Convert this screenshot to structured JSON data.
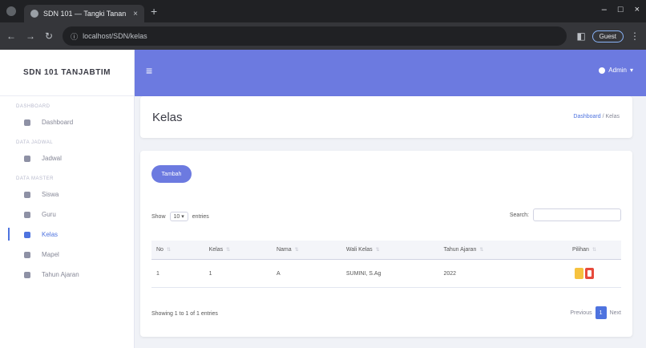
{
  "browser": {
    "tab_title": "SDN 101 — Tangki Tanan",
    "tab_close": "×",
    "new_tab": "+",
    "window_controls": [
      "–",
      "□",
      "×"
    ],
    "address": "localhost/SDN/kelas",
    "profile": "Guest"
  },
  "sidebar": {
    "brand": "SDN 101 TANJABTIM",
    "headings": [
      "DASHBOARD",
      "DATA JADWAL",
      "DATA MASTER"
    ],
    "items": [
      {
        "label": "Dashboard",
        "icon": "gauge-icon"
      },
      {
        "label": "Jadwal",
        "icon": "calendar-icon"
      },
      {
        "label": "Siswa",
        "icon": "user-icon"
      },
      {
        "label": "Guru",
        "icon": "user-icon"
      },
      {
        "label": "Kelas",
        "icon": "table-icon"
      },
      {
        "label": "Mapel",
        "icon": "book-icon"
      },
      {
        "label": "Tahun Ajaran",
        "icon": "calendar-icon"
      }
    ]
  },
  "topbar": {
    "menu_icon": "≡",
    "user": "Admin"
  },
  "header": {
    "title": "Kelas",
    "breadcrumb_link": "Dashboard",
    "breadcrumb_sep": " / ",
    "breadcrumb_current": "Kelas"
  },
  "content": {
    "add_button": "Tambah",
    "show_label": "Show",
    "show_value": "10",
    "entries_label": "entries",
    "search_label": "Search:",
    "search_value": "",
    "columns": [
      "No",
      "Kelas",
      "Nama",
      "Wali Kelas",
      "Tahun Ajaran",
      "Pilihan"
    ],
    "rows": [
      {
        "no": "1",
        "kelas": "1",
        "nama": "A",
        "wali": "SUMINI, S.Ag",
        "tahun": "2022"
      }
    ],
    "info": "Showing 1 to 1 of 1 entries",
    "pager_prev": "Previous",
    "pager_page": "1",
    "pager_next": "Next"
  },
  "colors": {
    "primary": "#6c7ae0",
    "accent": "#4e73df",
    "edit": "#f6c23e",
    "delete": "#e74a3b"
  }
}
